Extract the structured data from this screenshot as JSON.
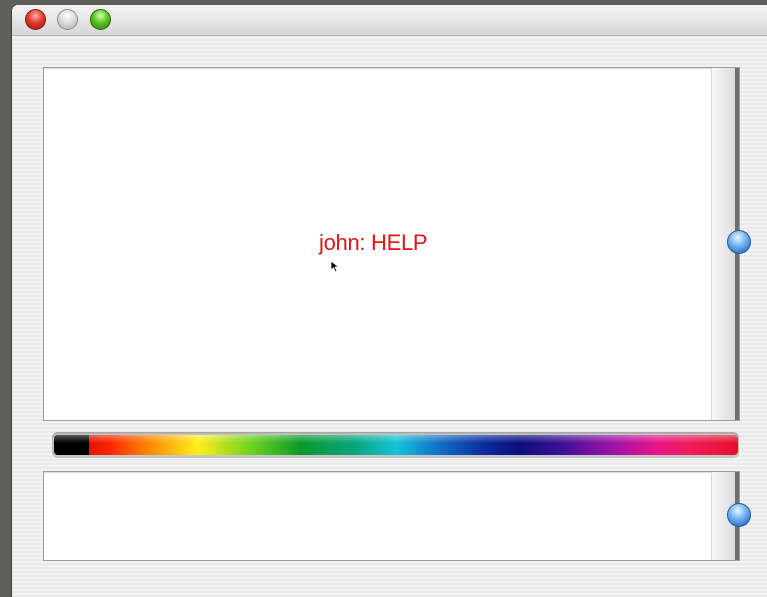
{
  "window": {
    "controls": {
      "close_icon": "close-icon",
      "minimize_icon": "minimize-icon",
      "zoom_icon": "zoom-icon"
    }
  },
  "chat": {
    "messages": [
      {
        "text": "john: HELP",
        "color": "#e0141a"
      }
    ]
  },
  "input": {
    "value": ""
  },
  "color_picker": {
    "selected_color": "#000000"
  }
}
